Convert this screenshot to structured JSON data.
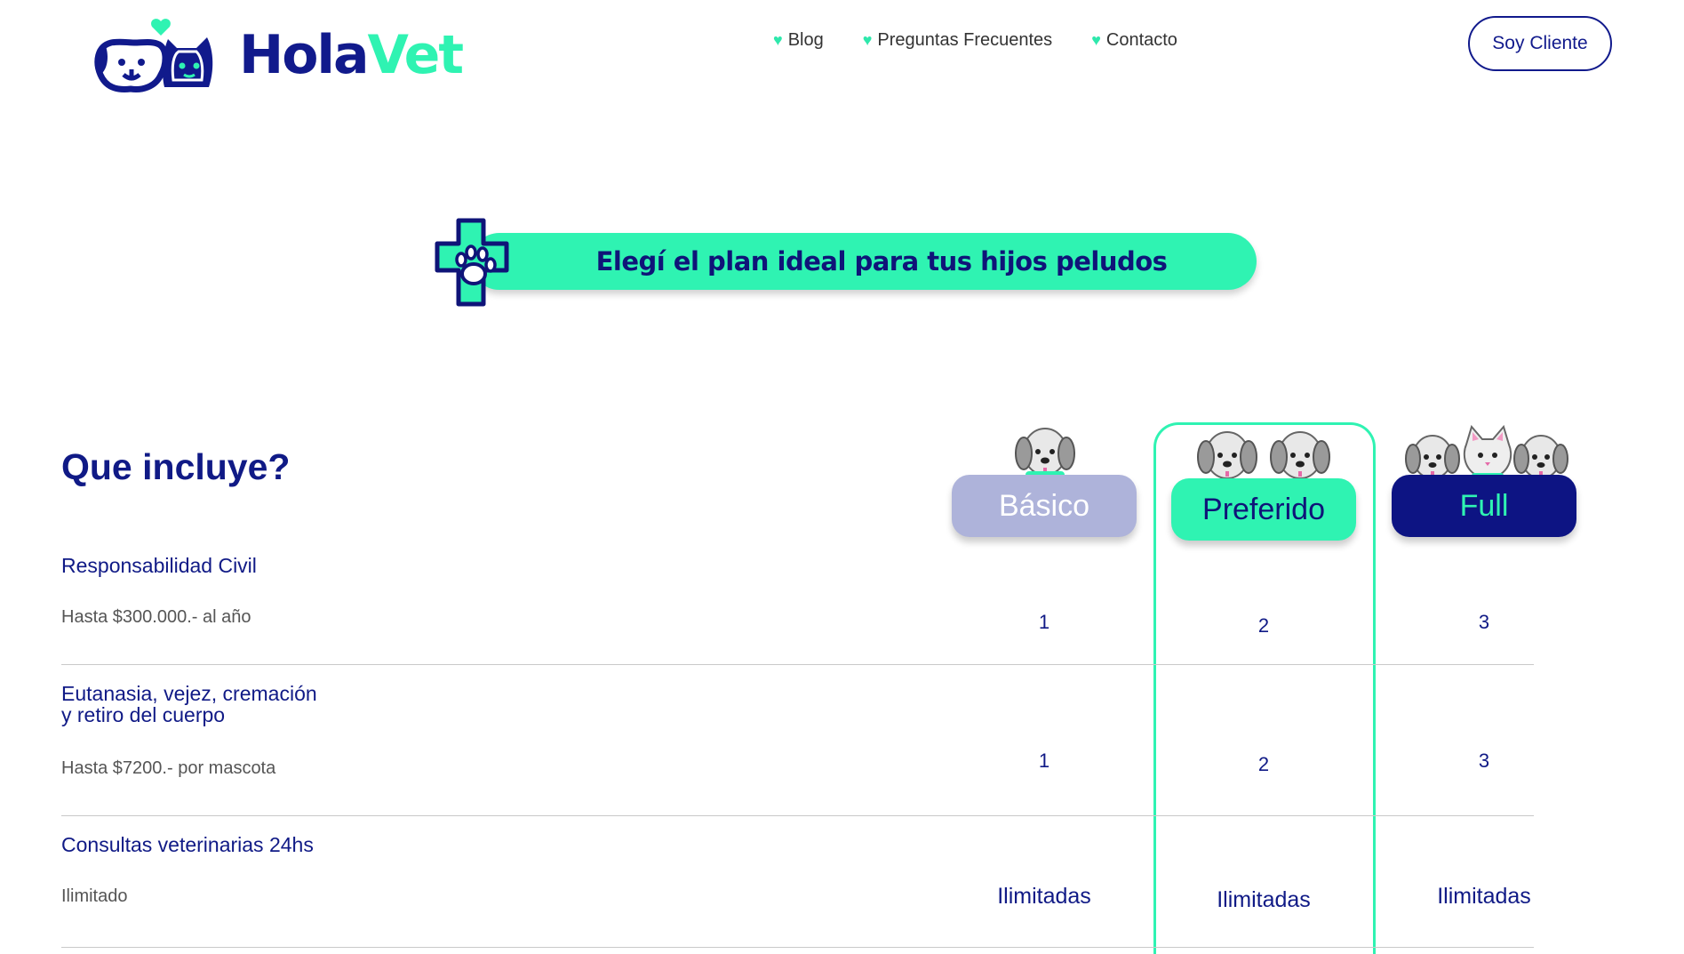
{
  "brand": {
    "name_part1": "Hola",
    "name_part2": "Vet",
    "primary_color": "#111a8c",
    "accent_color": "#2ff3b2"
  },
  "nav": {
    "items": [
      {
        "label": "Blog"
      },
      {
        "label": "Preguntas Frecuentes"
      },
      {
        "label": "Contacto"
      }
    ],
    "cta_label": "Soy Cliente"
  },
  "banner": {
    "text": "Elegí el plan ideal para tus hijos peludos",
    "icon": "medical-paw-icon"
  },
  "table": {
    "title": "Que incluye?",
    "plans": [
      {
        "name": "Básico",
        "pets_icon": "one-dog-icon"
      },
      {
        "name": "Preferido",
        "pets_icon": "two-dogs-icon"
      },
      {
        "name": "Full",
        "pets_icon": "dog-cat-dog-icon"
      }
    ],
    "rows": [
      {
        "title": "Responsabilidad Civil",
        "desc": "Hasta $300.000.- al año",
        "values": [
          "1",
          "2",
          "3"
        ]
      },
      {
        "title_line1": "Eutanasia, vejez, cremación",
        "title_line2": "y retiro del cuerpo",
        "desc": "Hasta $7200.- por mascota",
        "values": [
          "1",
          "2",
          "3"
        ]
      },
      {
        "title": "Consultas veterinarias 24hs",
        "desc": "Ilimitado",
        "values": [
          "Ilimitadas",
          "Ilimitadas",
          "Ilimitadas"
        ]
      }
    ]
  }
}
